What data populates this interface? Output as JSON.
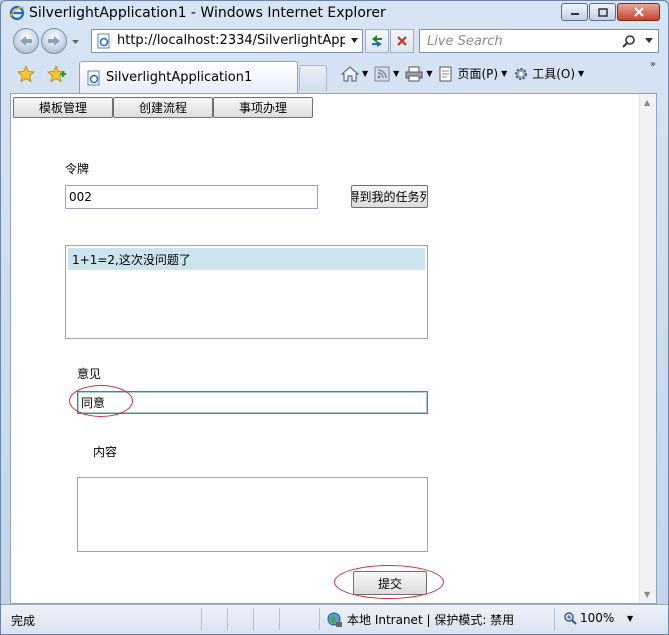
{
  "window": {
    "title": "SilverlightApplication1 - Windows Internet Explorer"
  },
  "address_bar": {
    "url": "http://localhost:2334/SilverlightApplicat",
    "search_placeholder": "Live Search"
  },
  "tab": {
    "label": "SilverlightApplication1"
  },
  "command_bar": {
    "page_label": "页面(P)",
    "tools_label": "工具(O)"
  },
  "app": {
    "menu": [
      "模板管理",
      "创建流程",
      "事项办理"
    ],
    "token_label": "令牌",
    "token_value": "002",
    "get_tasks_button": "得到我的任务列",
    "task_list": [
      "1+1=2,这次没问题了"
    ],
    "opinion_label": "意见",
    "opinion_value": "同意",
    "content_label": "内容",
    "content_value": "",
    "submit_button": "提交"
  },
  "status_bar": {
    "status": "完成",
    "zone": "本地 Intranet | 保护模式: 禁用",
    "zoom": "100%"
  },
  "colors": {
    "annotation_ellipse": "#c8343a",
    "list_selection": "#cce4ed"
  }
}
